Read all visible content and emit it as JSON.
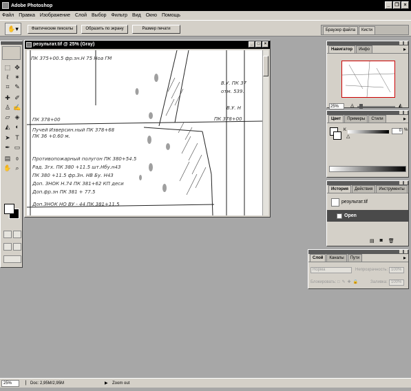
{
  "app": {
    "title": "Adobe Photoshop"
  },
  "menu": [
    "Файл",
    "Правка",
    "Изображение",
    "Слой",
    "Выбор",
    "Фильтр",
    "Вид",
    "Окно",
    "Помощь"
  ],
  "options_bar": {
    "buttons": [
      "Фактические пикселы",
      "Образить по экрану",
      "Размер печати"
    ]
  },
  "dock_tabs": [
    "Браузер файла",
    "Кисти"
  ],
  "document": {
    "title": "результат.tif @ 25% (Gray)"
  },
  "navigator": {
    "tabs": [
      "Навигатор",
      "Инфо"
    ],
    "zoom": "25%"
  },
  "color": {
    "tabs": [
      "Цвет",
      "Примеры",
      "Стили"
    ],
    "channel_label": "K",
    "value": "0",
    "unit": "%"
  },
  "history": {
    "tabs": [
      "История",
      "Действия",
      "Инструменты"
    ],
    "snapshot": "результат.tif",
    "steps": [
      "Open"
    ]
  },
  "layers": {
    "tabs": [
      "Слой",
      "Каналы",
      "Пути"
    ],
    "blend_mode": "Норма",
    "opacity_label": "Непрозрачность:",
    "opacity_value": "100%",
    "lock_label": "Блокировать:",
    "fill_label": "Заливка:",
    "fill_value": "100%"
  },
  "status": {
    "zoom": "25%",
    "doc": "Doc: 2,95M/2,95M",
    "message": "Zoom out"
  },
  "colors": {
    "accent": "#4a4a4a",
    "chrome": "#d4d0c8",
    "workspace": "#a7a7a7"
  },
  "icons": [
    "move-icon",
    "marquee-icon",
    "lasso-icon",
    "magic-wand-icon",
    "crop-icon",
    "slice-icon",
    "brush-icon",
    "stamp-icon",
    "eraser-icon",
    "gradient-icon",
    "dodge-icon",
    "path-select-icon",
    "type-icon",
    "pen-icon",
    "shape-icon",
    "notes-icon",
    "eyedropper-icon",
    "hand-icon",
    "zoom-icon"
  ]
}
